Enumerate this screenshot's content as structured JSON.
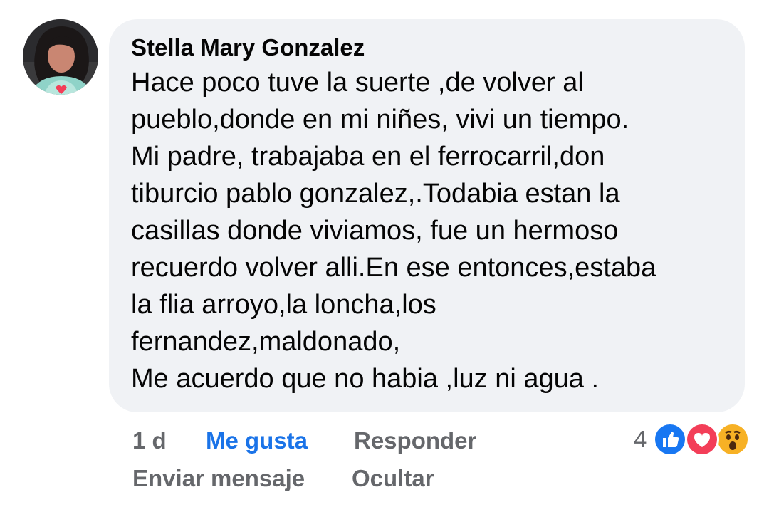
{
  "comment": {
    "author": "Stella Mary Gonzalez",
    "text_lines": [
      "Hace poco tuve la suerte ,de volver al",
      "pueblo,donde en mi niñes, vivi un tiempo.",
      "Mi padre, trabajaba en el ferrocarril,don",
      "tiburcio pablo gonzalez,.Todabia estan la",
      "casillas donde viviamos, fue un hermoso",
      "recuerdo volver alli.En ese entonces,estaba",
      "la flia arroyo,la loncha,los",
      "fernandez,maldonado,",
      "Me acuerdo que no habia ,luz ni agua ."
    ]
  },
  "actions": {
    "time": "1 d",
    "like": "Me gusta",
    "reply": "Responder",
    "send_message": "Enviar mensaje",
    "hide": "Ocultar"
  },
  "reactions": {
    "count": "4",
    "icons": [
      "like-icon",
      "love-icon",
      "wow-icon"
    ]
  },
  "colors": {
    "bubble": "#f0f2f5",
    "like_blue": "#1a73e8",
    "secondary_text": "#65676b",
    "love_red": "#f33e58",
    "wow_yellow": "#f7b125"
  }
}
